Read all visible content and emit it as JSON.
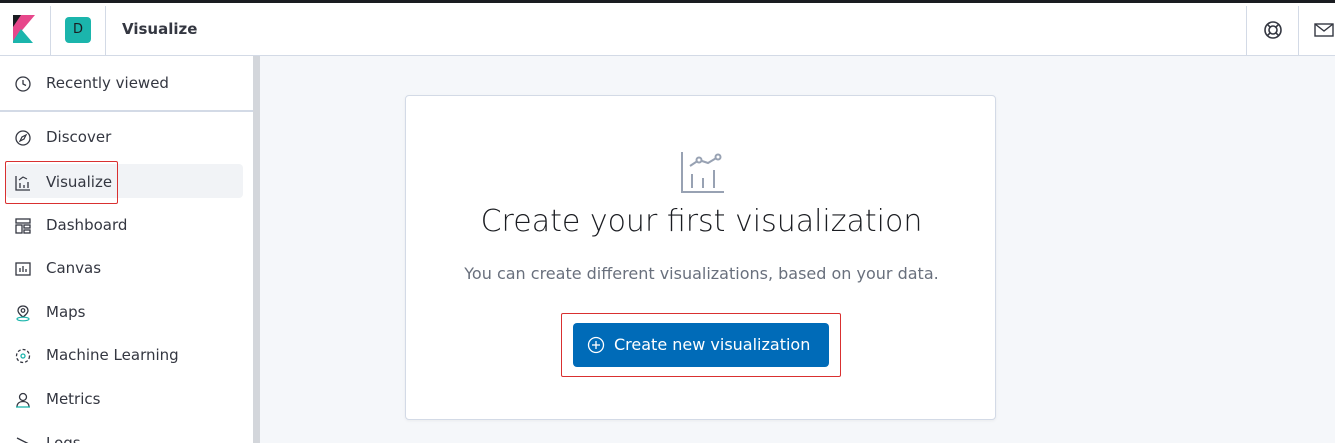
{
  "header": {
    "space_initial": "D",
    "title": "Visualize"
  },
  "sidebar": {
    "recent": {
      "label": "Recently viewed",
      "icon": "clock-icon"
    },
    "items": [
      {
        "label": "Discover",
        "icon": "compass-icon"
      },
      {
        "label": "Visualize",
        "icon": "visualize-icon",
        "active": true
      },
      {
        "label": "Dashboard",
        "icon": "dashboard-icon"
      },
      {
        "label": "Canvas",
        "icon": "canvas-icon"
      },
      {
        "label": "Maps",
        "icon": "maps-icon"
      },
      {
        "label": "Machine Learning",
        "icon": "machine-learning-icon"
      },
      {
        "label": "Metrics",
        "icon": "metrics-icon"
      },
      {
        "label": "Logs",
        "icon": "logs-icon"
      }
    ]
  },
  "main": {
    "title": "Create your first visualization",
    "subtitle": "You can create different visualizations, based on your data.",
    "create_button": "Create new visualization"
  },
  "colors": {
    "accent": "#006bb8",
    "space_avatar": "#1bb5ac",
    "highlight_box": "#d93030"
  }
}
